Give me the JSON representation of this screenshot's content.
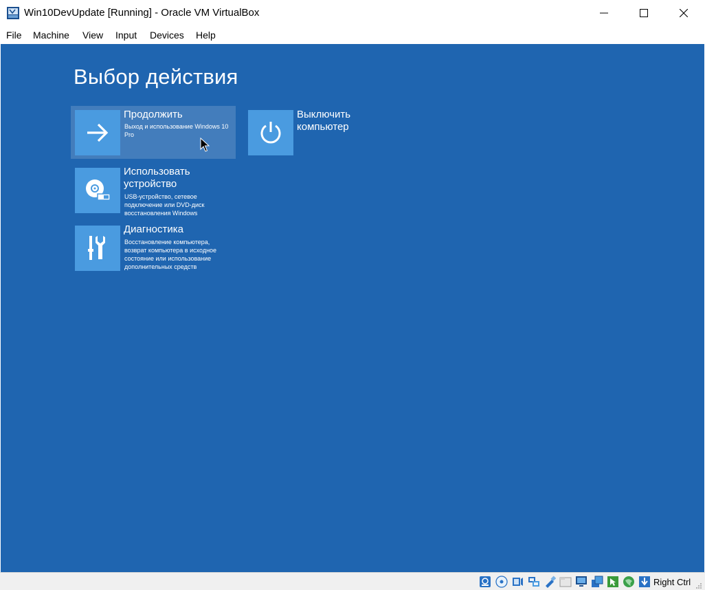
{
  "window": {
    "title": "Win10DevUpdate [Running] - Oracle VM VirtualBox",
    "app_icon": "virtualbox-icon"
  },
  "menu": [
    "File",
    "Machine",
    "View",
    "Input",
    "Devices",
    "Help"
  ],
  "screen": {
    "title": "Выбор действия",
    "background_color": "#1f65b0",
    "tile_color": "#4a9be0",
    "options": [
      {
        "id": "continue",
        "icon": "arrow-right-icon",
        "title_lines": [
          "Продолжить"
        ],
        "desc_lines": [
          "Выход и использование Windows 10",
          "Pro"
        ],
        "highlighted": true
      },
      {
        "id": "use-device",
        "icon": "disc-drive-icon",
        "title_lines": [
          "Использовать",
          "устройство"
        ],
        "desc_lines": [
          "USB-устройство, сетевое",
          "подключение или DVD-диск",
          "восстановления Windows"
        ],
        "highlighted": false
      },
      {
        "id": "diagnostics",
        "icon": "tools-icon",
        "title_lines": [
          "Диагностика"
        ],
        "desc_lines": [
          "Восстановление компьютера,",
          "возврат компьютера в исходное",
          "состояние или использование",
          "дополнительных средств"
        ],
        "highlighted": false
      },
      {
        "id": "power-off",
        "icon": "power-icon",
        "title_lines": [
          "Выключить",
          "компьютер"
        ],
        "desc_lines": [],
        "highlighted": false
      }
    ]
  },
  "statusbar": {
    "icons": [
      "hard-disk-icon",
      "optical-drive-icon",
      "audio-icon",
      "network-icon",
      "usb-icon",
      "shared-folders-icon",
      "display-icon",
      "video-capture-icon",
      "mouse-integration-icon",
      "cpu-icon",
      "keyboard-capture-icon"
    ],
    "host_key": "Right Ctrl"
  }
}
